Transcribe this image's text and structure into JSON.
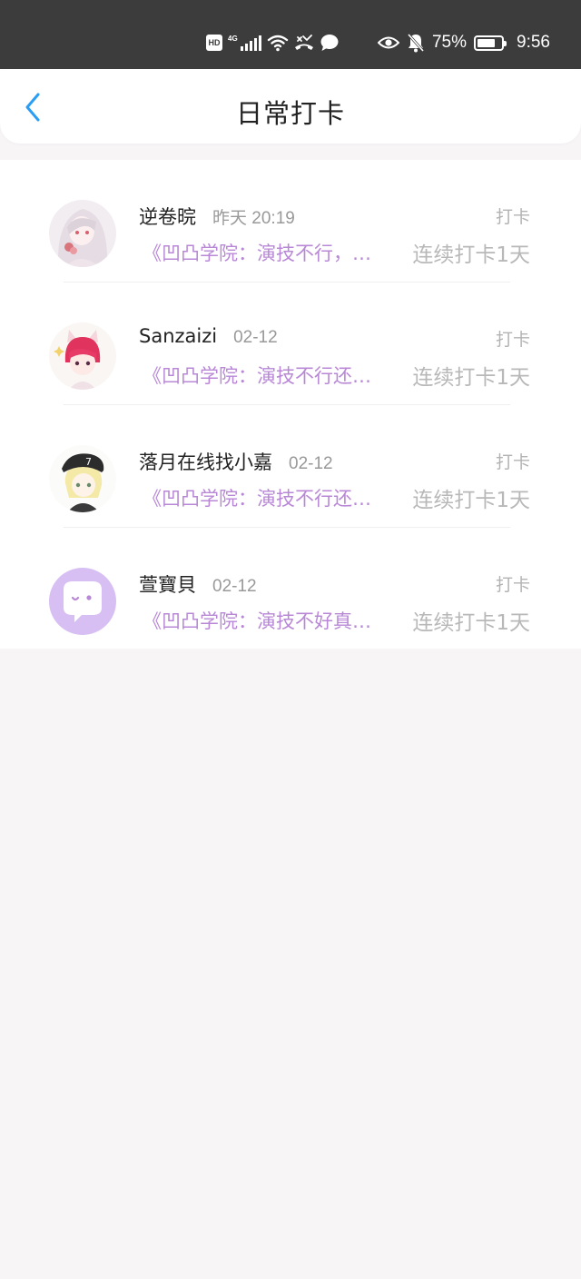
{
  "status_bar": {
    "network_type": "4G",
    "battery": "75%",
    "battery_level": 0.75,
    "time": "9:56",
    "icons": [
      "hd-icon",
      "signal-icon",
      "wifi-icon",
      "missed-call-icon",
      "message-icon",
      "eye-icon",
      "mute-bell-icon",
      "battery-icon"
    ]
  },
  "header": {
    "title": "日常打卡",
    "back_icon": "chevron-left-icon",
    "accent_color": "#2a9df4"
  },
  "colors": {
    "post_title": "#b888d6",
    "avatar_default": "#d7bff3"
  },
  "checkins": [
    {
      "username": "逆卷晥",
      "time": "昨天 20:19",
      "action": "打卡",
      "post_title": "《凹凸学院：演技不行，…",
      "streak": "连续打卡1天",
      "avatar": "girl-illustration-avatar"
    },
    {
      "username": "Sanzaizi",
      "time": "02-12",
      "action": "打卡",
      "post_title": "《凹凸学院：演技不行还…",
      "streak": "连续打卡1天",
      "avatar": "cat-ear-boy-avatar"
    },
    {
      "username": "落月在线找小嘉",
      "time": "02-12",
      "action": "打卡",
      "post_title": "《凹凸学院：演技不行还…",
      "streak": "连续打卡1天",
      "avatar": "cap-boy-avatar"
    },
    {
      "username": "萱寶貝",
      "time": "02-12",
      "action": "打卡",
      "post_title": "《凹凸学院：演技不好真…",
      "streak": "连续打卡1天",
      "avatar": "default-chat-bubble-avatar"
    }
  ]
}
